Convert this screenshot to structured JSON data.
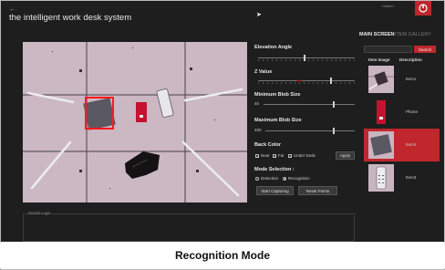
{
  "header": {
    "back": "←",
    "title": "the intelligent work desk system",
    "status": "Hidden",
    "logo_icon": "robot-face-icon",
    "accent": "#c0272d"
  },
  "controls": {
    "elevation_label": "Elevation Angle",
    "elevation_value": 0.48,
    "z_label": "Z Value",
    "z_value": 0.76,
    "min_blob_label": "Minimum Blob Size",
    "min_blob_value": "40",
    "max_blob_label": "Maximum Blob Size",
    "max_blob_value": "400",
    "back_color_label": "Back Color",
    "near_label": "Near",
    "far_label": "Far",
    "under_desk_label": "Under Desk",
    "apply_label": "Apply",
    "mode_label": "Mode Selection :",
    "detection_label": "Detection",
    "recognition_label": "Recognition",
    "start_label": "Start Capturing",
    "reset_label": "Reset Points"
  },
  "tabs": {
    "main": "MAIN SCREEN",
    "gallery": "ITEM GALLERY"
  },
  "search": {
    "button": "Search"
  },
  "gallery": {
    "col_image": "Item Image",
    "col_desc": "Description",
    "items": [
      {
        "desc": "Item1"
      },
      {
        "desc": "Phone"
      },
      {
        "desc": "Item2"
      },
      {
        "desc": "Item3"
      }
    ]
  },
  "results": {
    "label": "Result Logs"
  },
  "caption": "Recognition Mode"
}
